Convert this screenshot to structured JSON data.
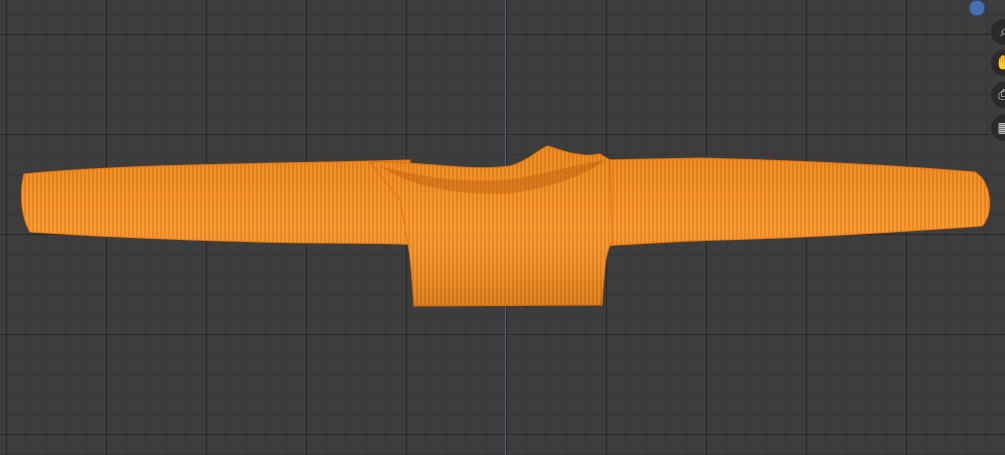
{
  "viewport": {
    "background_color": "#3d3d3d",
    "grid_color": "#2a2a2a",
    "axis_line_color": "#4d6fa3"
  },
  "mesh": {
    "object": "sweater",
    "color": "#f58a1f",
    "edge_color": "#e07310",
    "display": "wireframe"
  },
  "navigation_gizmo": {
    "axis_dot_color": "#4a6fb4",
    "buttons": [
      {
        "icon": "zoom-icon",
        "glyph": "⌕"
      },
      {
        "icon": "pan-hand-icon",
        "glyph": "✋"
      },
      {
        "icon": "camera-view-icon",
        "glyph": "⎙"
      },
      {
        "icon": "grid-toggle-icon",
        "glyph": "▦"
      }
    ]
  }
}
